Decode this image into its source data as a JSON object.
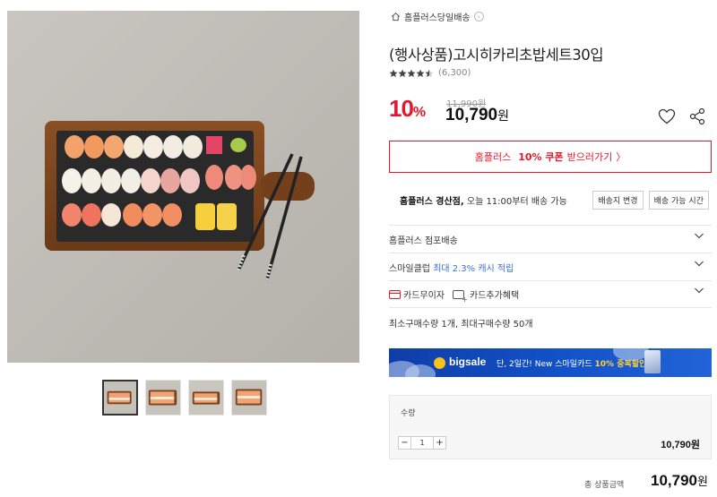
{
  "product": {
    "store_link": "홈플러스당일배송",
    "title": "(행사상품)고시히카리초밥세트30입",
    "rating": 4.5,
    "review_count": "(6,300)",
    "discount_rate": "10",
    "discount_unit": "%",
    "original_price": "11,990원",
    "sale_price": "10,790",
    "sale_unit": "원",
    "image_desc": "sushi-platter-photo"
  },
  "coupon": {
    "store": "홈플러스",
    "amount": "10% 쿠폰",
    "action": "받으러가기",
    "arrow": "〉"
  },
  "delivery": {
    "store": "홈플러스 경산점,",
    "info": " 오늘 11:00부터 배송 가능",
    "change_btn": "배송지 변경",
    "time_btn": "배송 가능 시간"
  },
  "accordion": {
    "store_delivery": "홈플러스 점포배송",
    "smile_prefix": "스마일클럽",
    "smile_benefit": "최대 2.3% 캐시 적립",
    "card_interest": "카드무이자",
    "card_benefit": "카드추가혜택"
  },
  "purchase_limit": "최소구매수량 1개, 최대구매수량 50개",
  "banner": {
    "brand": "bigsale",
    "msg_prefix": "단, 2일간! New 스마일카드",
    "msg_highlight": "10% 중복할인"
  },
  "quantity": {
    "label": "수량",
    "value": "1",
    "minus": "−",
    "plus": "+",
    "line_price": "10,790원"
  },
  "total": {
    "label": "총 상품금액",
    "price": "10,790",
    "unit": "원"
  },
  "colors": {
    "accent_red": "#e5172c",
    "link_blue": "#3b6fd8",
    "banner_blue": "#1352c9"
  },
  "icons": [
    "home-icon",
    "chevron-right-icon",
    "star-icon",
    "heart-icon",
    "share-icon",
    "chevron-down-icon",
    "card-icon"
  ]
}
